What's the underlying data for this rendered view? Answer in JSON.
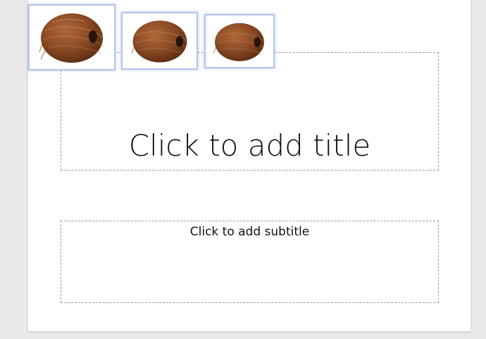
{
  "slide": {
    "title_placeholder": "Click to add title",
    "subtitle_placeholder": "Click to add subtitle"
  },
  "images": [
    {
      "icon": "coconut-image"
    },
    {
      "icon": "coconut-image"
    },
    {
      "icon": "coconut-image"
    }
  ],
  "colors": {
    "selection_border": "#b3c4ea",
    "placeholder_border": "#9a9a9a",
    "coconut_shell": "#8a4a24",
    "workspace": "#e9e9e9"
  }
}
